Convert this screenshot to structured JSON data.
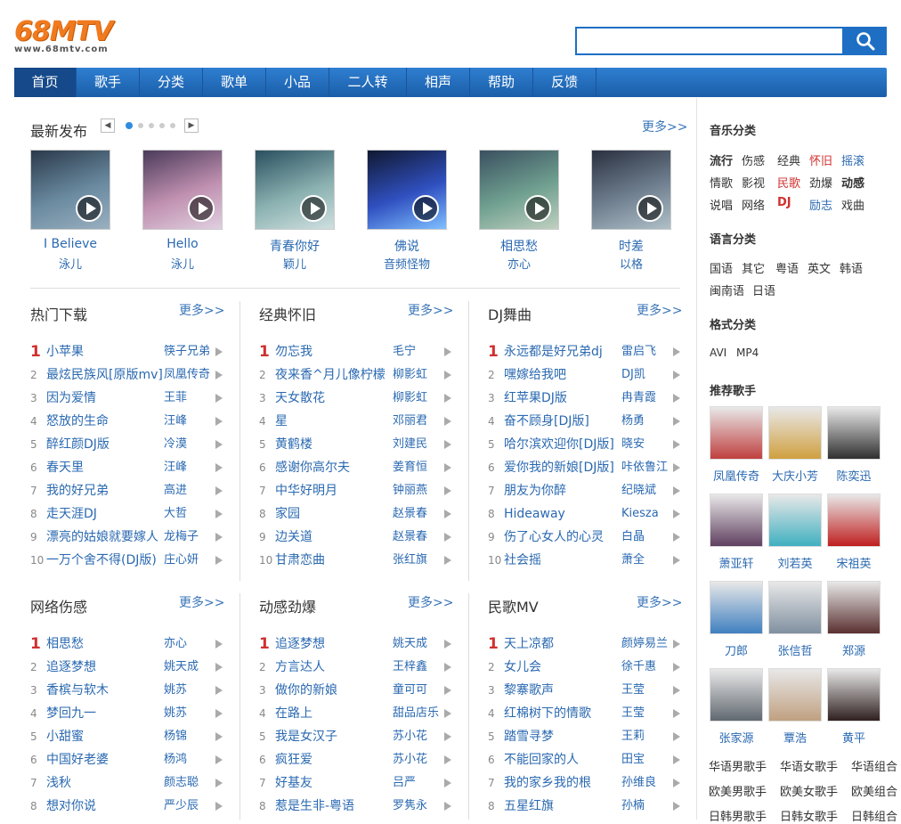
{
  "logo": {
    "text": "68MTV",
    "url": "www.68mtv.com"
  },
  "search": {
    "placeholder": "",
    "value": ""
  },
  "nav": [
    "首页",
    "歌手",
    "分类",
    "歌单",
    "小品",
    "二人转",
    "相声",
    "帮助",
    "反馈"
  ],
  "latest": {
    "title": "最新发布",
    "more": "更多>>",
    "items": [
      {
        "name": "I Believe",
        "artist": "泳儿"
      },
      {
        "name": "Hello",
        "artist": "泳儿"
      },
      {
        "name": "青春你好",
        "artist": "颖儿"
      },
      {
        "name": "佛说",
        "artist": "音频怪物"
      },
      {
        "name": "相思愁",
        "artist": "亦心"
      },
      {
        "name": "时差",
        "artist": "以格"
      }
    ]
  },
  "lists": [
    {
      "title": "热门下载",
      "more": "更多>>",
      "rows": [
        [
          "1",
          "小苹果",
          "筷子兄弟"
        ],
        [
          "2",
          "最炫民族风[原版mv]",
          "凤凰传奇"
        ],
        [
          "3",
          "因为爱情",
          "王菲"
        ],
        [
          "4",
          "怒放的生命",
          "汪峰"
        ],
        [
          "5",
          "醉红颜DJ版",
          "冷漠"
        ],
        [
          "6",
          "春天里",
          "汪峰"
        ],
        [
          "7",
          "我的好兄弟",
          "高进"
        ],
        [
          "8",
          "走天涯DJ",
          "大哲"
        ],
        [
          "9",
          "漂亮的姑娘就要嫁人",
          "龙梅子"
        ],
        [
          "10",
          "一万个舍不得(DJ版)",
          "庄心妍"
        ]
      ]
    },
    {
      "title": "经典怀旧",
      "more": "更多>>",
      "rows": [
        [
          "1",
          "勿忘我",
          "毛宁"
        ],
        [
          "2",
          "夜来香^月儿像柠檬",
          "柳影虹"
        ],
        [
          "3",
          "天女散花",
          "柳影虹"
        ],
        [
          "4",
          "星",
          "邓丽君"
        ],
        [
          "5",
          "黄鹤楼",
          "刘建民"
        ],
        [
          "6",
          "感谢你高尔夫",
          "姜育恒"
        ],
        [
          "7",
          "中华好明月",
          "钟丽燕"
        ],
        [
          "8",
          "家园",
          "赵景春"
        ],
        [
          "9",
          "边关道",
          "赵景春"
        ],
        [
          "10",
          "甘肃恋曲",
          "张红旗"
        ]
      ]
    },
    {
      "title": "DJ舞曲",
      "more": "更多>>",
      "rows": [
        [
          "1",
          "永远都是好兄弟dj",
          "雷启飞"
        ],
        [
          "2",
          "嘿嫁给我吧",
          "DJ凯"
        ],
        [
          "3",
          "红苹果DJ版",
          "冉青霞"
        ],
        [
          "4",
          "奋不顾身[DJ版]",
          "杨勇"
        ],
        [
          "5",
          "哈尔滨欢迎你[DJ版]",
          "晓安"
        ],
        [
          "6",
          "爱你我的新娘[DJ版]",
          "咔依鲁江"
        ],
        [
          "7",
          "朋友为你醉",
          "纪晓斌"
        ],
        [
          "8",
          "Hideaway",
          "Kiesza"
        ],
        [
          "9",
          "伤了心女人的心灵",
          "白晶"
        ],
        [
          "10",
          "社会摇",
          "萧全"
        ]
      ]
    },
    {
      "title": "网络伤感",
      "more": "更多>>",
      "rows": [
        [
          "1",
          "相思愁",
          "亦心"
        ],
        [
          "2",
          "追逐梦想",
          "姚天成"
        ],
        [
          "3",
          "香槟与软木",
          "姚苏"
        ],
        [
          "4",
          "梦回九一",
          "姚苏"
        ],
        [
          "5",
          "小甜蜜",
          "杨锦"
        ],
        [
          "6",
          "中国好老婆",
          "杨鸿"
        ],
        [
          "7",
          "浅秋",
          "颜志聪"
        ],
        [
          "8",
          "想对你说",
          "严少辰"
        ]
      ]
    },
    {
      "title": "动感劲爆",
      "more": "更多>>",
      "rows": [
        [
          "1",
          "追逐梦想",
          "姚天成"
        ],
        [
          "2",
          "方言达人",
          "王梓鑫"
        ],
        [
          "3",
          "做你的新娘",
          "童可可"
        ],
        [
          "4",
          "在路上",
          "甜品店乐"
        ],
        [
          "5",
          "我是女汉子",
          "苏小花"
        ],
        [
          "6",
          "疯狂爱",
          "苏小花"
        ],
        [
          "7",
          "好基友",
          "吕严"
        ],
        [
          "8",
          "惹是生非-粤语",
          "罗隽永"
        ]
      ]
    },
    {
      "title": "民歌MV",
      "more": "更多>>",
      "rows": [
        [
          "1",
          "天上凉都",
          "颜婷易兰"
        ],
        [
          "2",
          "女儿会",
          "徐千惠"
        ],
        [
          "3",
          "黎寨歌声",
          "王莹"
        ],
        [
          "4",
          "红棉树下的情歌",
          "王莹"
        ],
        [
          "5",
          "踏雪寻梦",
          "王莉"
        ],
        [
          "6",
          "不能回家的人",
          "田宝"
        ],
        [
          "7",
          "我的家乡我的根",
          "孙维良"
        ],
        [
          "8",
          "五星红旗",
          "孙楠"
        ]
      ]
    }
  ],
  "sidebar": {
    "music_title": "音乐分类",
    "music_tags": [
      [
        "流行",
        "伤感",
        "经典",
        "怀旧",
        "摇滚"
      ],
      [
        "情歌",
        "影视",
        "民歌",
        "劲爆",
        "动感"
      ],
      [
        "说唱",
        "网络",
        "DJ",
        "励志",
        "戏曲"
      ]
    ],
    "lang_title": "语言分类",
    "lang_tags": [
      [
        "国语",
        "其它",
        "粤语",
        "英文",
        "韩语"
      ],
      [
        "闽南语",
        "日语"
      ]
    ],
    "format_title": "格式分类",
    "format_tags": [
      "AVI",
      "MP4"
    ],
    "singer_title": "推荐歌手",
    "singers": [
      "凤凰传奇",
      "大庆小芳",
      "陈奕迅",
      "萧亚轩",
      "刘若英",
      "宋祖英",
      "刀郎",
      "张信哲",
      "郑源",
      "张家源",
      "覃浩",
      "黄平"
    ],
    "groups": [
      [
        "华语男歌手",
        "华语女歌手",
        "华语组合"
      ],
      [
        "欧美男歌手",
        "欧美女歌手",
        "欧美组合"
      ],
      [
        "日韩男歌手",
        "日韩女歌手",
        "日韩组合"
      ]
    ]
  }
}
